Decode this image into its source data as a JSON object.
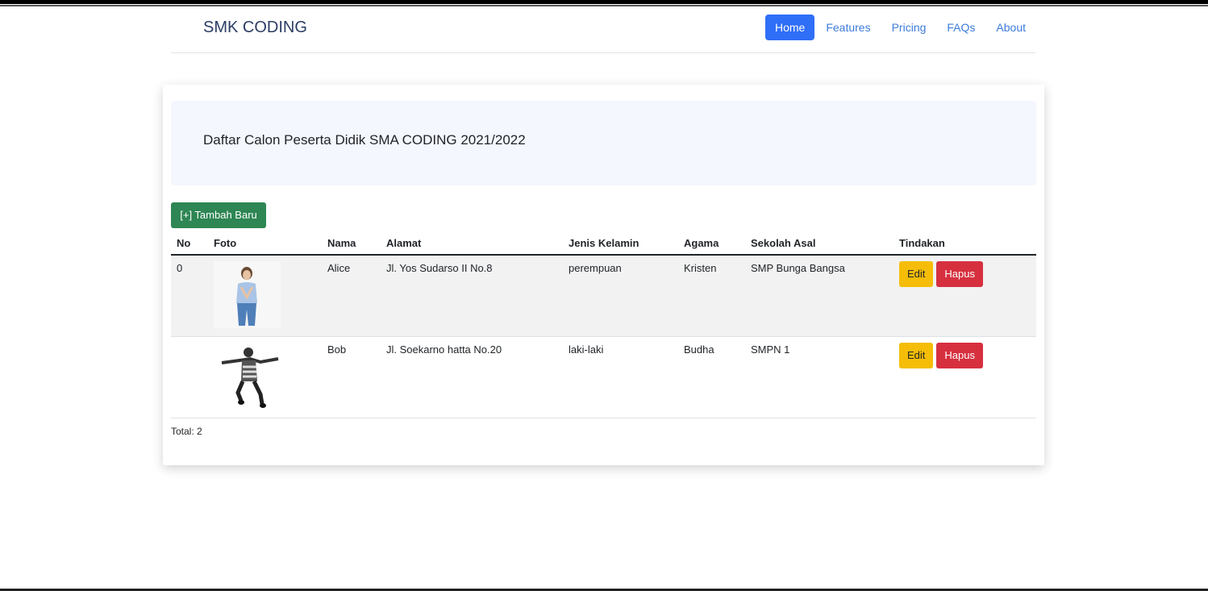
{
  "header": {
    "brand": "SMK CODING",
    "nav": [
      "Home",
      "Features",
      "Pricing",
      "FAQs",
      "About"
    ],
    "active_nav": "Home"
  },
  "page": {
    "title": "Daftar Calon Peserta Didik SMA CODING 2021/2022",
    "add_button": "[+] Tambah Baru",
    "total": "Total: 2"
  },
  "table": {
    "columns": [
      "No",
      "Foto",
      "Nama",
      "Alamat",
      "Jenis Kelamin",
      "Agama",
      "Sekolah Asal",
      "Tindakan"
    ],
    "rows": [
      {
        "no": "0",
        "nama": "Alice",
        "alamat": "Jl. Yos Sudarso II No.8",
        "jenis_kelamin": "perempuan",
        "agama": "Kristen",
        "sekolah_asal": "SMP Bunga Bangsa",
        "edit": "Edit",
        "hapus": "Hapus"
      },
      {
        "no": "",
        "nama": "Bob",
        "alamat": "Jl. Soekarno hatta No.20",
        "jenis_kelamin": "laki-laki",
        "agama": "Budha",
        "sekolah_asal": "SMPN 1",
        "edit": "Edit",
        "hapus": "Hapus"
      }
    ]
  },
  "colors": {
    "primary": "#2f6ef7",
    "success": "#2d8653",
    "warning": "#f5bd07",
    "danger": "#d6303f",
    "jumbotron": "#f4f7fd"
  }
}
